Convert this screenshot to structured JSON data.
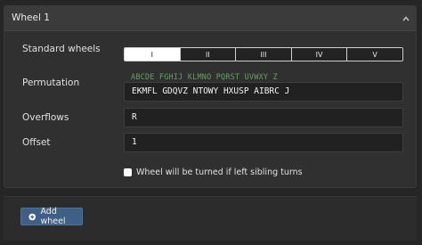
{
  "panel": {
    "title": "Wheel 1",
    "collapse_icon": "chevron-up-icon"
  },
  "standard_wheels": {
    "label": "Standard wheels",
    "options": [
      "I",
      "II",
      "III",
      "IV",
      "V"
    ],
    "selected": "I"
  },
  "permutation": {
    "label": "Permutation",
    "alphabet": "ABCDE FGHIJ KLMNO PQRST UVWXY Z",
    "value": "EKMFL GDQVZ NTOWY HXUSP AIBRC J"
  },
  "overflows": {
    "label": "Overflows",
    "value": "R"
  },
  "offset": {
    "label": "Offset",
    "value": "1"
  },
  "sibling_turn": {
    "label": "Wheel will be turned if left sibling turns",
    "checked": false
  },
  "footer": {
    "add_wheel_label": "Add wheel",
    "add_icon": "plus-circle-icon"
  },
  "colors": {
    "background": "#262626",
    "panel": "#303030",
    "accent_button": "#3e5f86",
    "alphabet_green": "#63a05f"
  }
}
